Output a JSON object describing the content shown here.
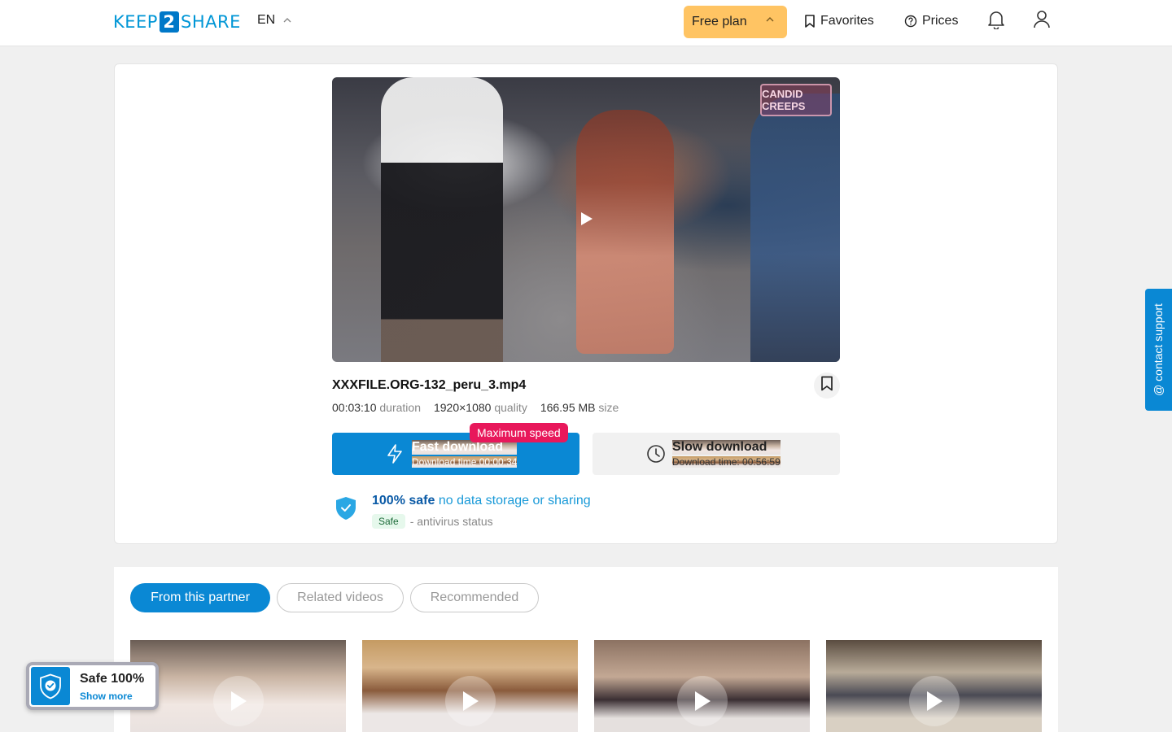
{
  "header": {
    "logo_left": "KEEP",
    "logo_num": "2",
    "logo_right": "SHARE",
    "language": "EN",
    "plan_label": "Free plan",
    "favorites_label": "Favorites",
    "prices_label": "Prices"
  },
  "video": {
    "watermark": "CANDID CREEPS",
    "filename": "XXXFILE.ORG-132_peru_3.mp4",
    "duration_value": "00:03:10",
    "duration_label": "duration",
    "quality_value": "1920×1080",
    "quality_label": "quality",
    "size_value": "166.95 MB",
    "size_label": "size"
  },
  "download": {
    "badge": "Maximum speed",
    "fast_title": "Fast download",
    "fast_time": "Download time 00:00:34",
    "slow_title": "Slow download",
    "slow_time": "Download time: 00:56:59"
  },
  "safety": {
    "bold": "100% safe",
    "text": "no data storage or sharing",
    "pill": "Safe",
    "status": "- antivirus status"
  },
  "tabs": [
    {
      "label": "From this partner",
      "active": true
    },
    {
      "label": "Related videos",
      "active": false
    },
    {
      "label": "Recommended",
      "active": false
    }
  ],
  "widget": {
    "title": "Safe 100%",
    "link": "Show more"
  },
  "support": {
    "label": "contact support"
  },
  "colors": {
    "accent": "#0a88d4",
    "plan": "#ffc463",
    "badge": "#e8185b"
  }
}
